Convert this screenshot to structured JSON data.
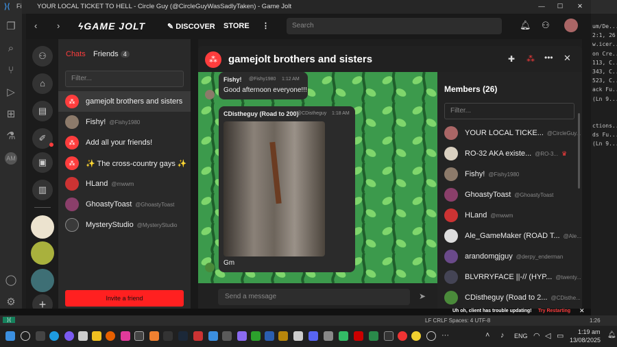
{
  "vscode": {
    "menu_label": "Fil",
    "right_lines": [
      "um/De...",
      "2:1, 26",
      "w.icer...",
      "on Cre...",
      "113, C...",
      "343, C...",
      "523, C...",
      "ack Fu...",
      "(Ln 9...",
      "",
      "",
      "ctions...",
      "ds Fu...",
      "(Ln 9..."
    ],
    "status_right": "1:26",
    "status_left": "LF  CRLF  Spaces: 4  UTF-8"
  },
  "window": {
    "title": "YOUR LOCAL TICKET TO HELL - Circle Guy (@CircleGuyWasSadlyTaken) - Game Jolt",
    "controls": [
      "—",
      "☐",
      "✕"
    ]
  },
  "nav": {
    "logo": "GAME JOLT",
    "discover": "DISCOVER",
    "store": "STORE",
    "more": "⋮",
    "search_placeholder": "Search"
  },
  "chat_panel": {
    "tab_chats": "Chats",
    "tab_friends": "Friends",
    "friends_count": "4",
    "filter_placeholder": "Filter...",
    "invite_label": "Invite a friend",
    "items": [
      {
        "name": "gamejolt brothers and sisters",
        "sub": "",
        "active": true
      },
      {
        "name": "Fishy!",
        "sub": "@Fishy1980"
      },
      {
        "name": "Add all your friends!",
        "sub": ""
      },
      {
        "name": "✨ The cross-country gays ✨",
        "sub": ""
      },
      {
        "name": "HLand",
        "sub": "@mwwm"
      },
      {
        "name": "GhoastyToast",
        "sub": "@GhoastyToast"
      },
      {
        "name": "MysteryStudio",
        "sub": "@MysteryStudio"
      }
    ]
  },
  "room": {
    "title": "gamejolt brothers and sisters",
    "messages": [
      {
        "author": "Fishy!",
        "handle": "@Fishy1980",
        "time": "1:12 AM",
        "text": "Good afternoon everyone!!!"
      },
      {
        "author": "CDistheguy (Road to 200)",
        "handle": "@CDistheguy",
        "time": "1:18 AM",
        "text": "Gm"
      }
    ],
    "send_placeholder": "Send a message"
  },
  "members": {
    "title": "Members (26)",
    "filter_placeholder": "Filter...",
    "list": [
      {
        "name": "YOUR LOCAL TICKE...",
        "sub": "@CircleGuy..."
      },
      {
        "name": "RO-32 AKA existe...",
        "sub": "@RO-3..."
      },
      {
        "name": "Fishy!",
        "sub": "@Fishy1980"
      },
      {
        "name": "GhoastyToast",
        "sub": "@GhoastyToast"
      },
      {
        "name": "HLand",
        "sub": "@mwwm"
      },
      {
        "name": "Ale_GameMaker (ROAD T...",
        "sub": "@Ale..."
      },
      {
        "name": "arandomgjguy",
        "sub": "@derpy_enderman"
      },
      {
        "name": "BLVRRYFACE ||-// (HYP...",
        "sub": "@twenty..."
      },
      {
        "name": "CDistheguy (Road to 2...",
        "sub": "@CDisthe..."
      }
    ]
  },
  "notification": {
    "text": "Uh oh, client has trouble updating!",
    "link": "Try Restarting"
  },
  "taskbar": {
    "lang": "ENG",
    "time": "1:19 am",
    "date": "13/08/2025",
    "more": "···"
  },
  "colors": {
    "accent": "#ff3d3d",
    "gj_green": "#2f7f3d"
  }
}
